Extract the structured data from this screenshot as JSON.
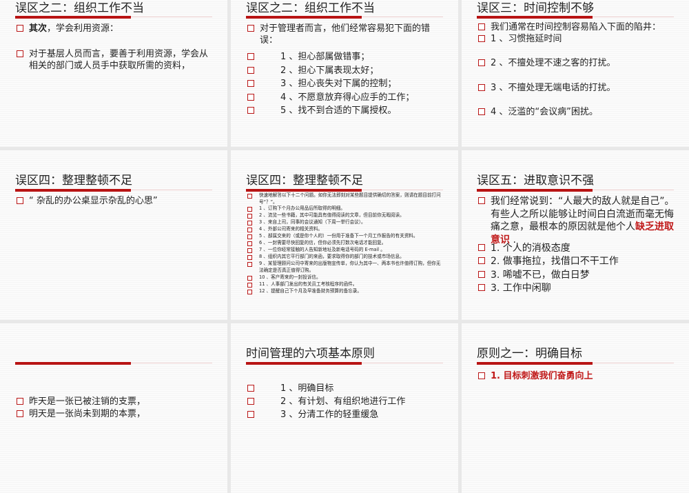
{
  "slides": [
    {
      "title": "误区之二：组织工作不当",
      "items": [
        {
          "bold": "其次",
          "text": "，学会利用资源："
        },
        {
          "text": "对于基层人员而言，要善于利用资源，学会从相关的部门或人员手中获取所需的资料，"
        }
      ]
    },
    {
      "title": "误区之二：组织工作不当",
      "items": [
        {
          "text": " 对于管理者而言，他们经常容易犯下面的错误："
        },
        {
          "text": "1 、担心部属做错事；"
        },
        {
          "text": "2 、担心下属表现太好；"
        },
        {
          "text": "3 、担心丧失对下属的控制；"
        },
        {
          "text": "4 、不愿意放弃得心应手的工作；"
        },
        {
          "text": "5 、找不到合适的下属授权。"
        }
      ]
    },
    {
      "title": "误区三：时间控制不够",
      "items": [
        {
          "text": "我们通常在时间控制容易陷入下面的陷井："
        },
        {
          "text": "1 、习惯拖延时间"
        },
        {
          "text": "2 、不擅处理不速之客的打扰。"
        },
        {
          "text": "3 、不擅处理无端电话的打扰。"
        },
        {
          "text": "4 、泛滥的“会议病”困扰。"
        }
      ]
    },
    {
      "title": "误区四：整理整顿不足",
      "items": [
        {
          "text": "“ 杂乱的办公桌显示杂乱的心思”"
        }
      ]
    },
    {
      "title": "误区四：整理整顿不足",
      "items": [
        {
          "text": "快速地解答以下十二个问题。如你无法即刻对某些题目提供确切的答案，则请在题目前打问号“？”。"
        },
        {
          "text": "1 、订购下个月办公用品后所取得的明细。"
        },
        {
          "text": "2 、流览一些书籍，其中可能具有值得阅读的文章，但目前你无暇阅读。"
        },
        {
          "text": "3 、来自上司，同事的会议通知（下周一举行会议）。"
        },
        {
          "text": "4 、外部公司寄来的相关资料。"
        },
        {
          "text": "5 、部属交来的（或是你个人的）一份用于准备下一个月工作报告的有关资料。"
        },
        {
          "text": "6 、一封需要尽快回复的信，但你必须先打数次电话才能回复。"
        },
        {
          "text": "7 、一位你经常接触的人告知新地址及新电话号码的 E-mail 。"
        },
        {
          "text": "8 、组织内其它平行部门的来函，要求取得你的部门的技术或市场信息。"
        },
        {
          "text": "9 、某管理顾问公司中寄来的出版物宣传单，你认为其中一、两本书也许值得订购，但你无法确定是否真正值得订购。"
        },
        {
          "text": "10 、客户寄来的一封投诉信。"
        },
        {
          "text": "11 、人事部门发出的有关员工考核程序的函件。"
        },
        {
          "text": "12 、提醒自己下个月及早准备财务预算的备忘录。"
        }
      ]
    },
    {
      "title": "误区五：进取意识不强",
      "items": [
        {
          "text": " 我们经常说到：“人最大的敌人就是自己”。有些人之所以能够让时间白白流逝而毫无悔痛之意，最根本的原因就是他个人",
          "red": "缺乏进取意识",
          "after": " ."
        },
        {
          "text": "1. 个人的消极态度"
        },
        {
          "text": "2. 做事拖拉，找借口不干工作"
        },
        {
          "text": "3. 唏嘘不已，做白日梦"
        },
        {
          "text": "3. 工作中闲聊"
        }
      ]
    },
    {
      "title": "",
      "items": [
        {
          "text": "昨天是一张已被注销的支票，"
        },
        {
          "text": "明天是一张尚未到期的本票，"
        }
      ]
    },
    {
      "title": "时间管理的六项基本原则",
      "items": [
        {
          "text": "1 、明确目标"
        },
        {
          "text": "2 、有计划、有组织地进行工作"
        },
        {
          "text": "3 、分清工作的轻重缓急"
        }
      ]
    },
    {
      "title": "原则之一：明确目标",
      "items": [
        {
          "red": "1. 目标刺激我们奋勇向上"
        }
      ]
    }
  ],
  "colors": {
    "accent": "#b81414",
    "background": "#e8e8e8"
  }
}
